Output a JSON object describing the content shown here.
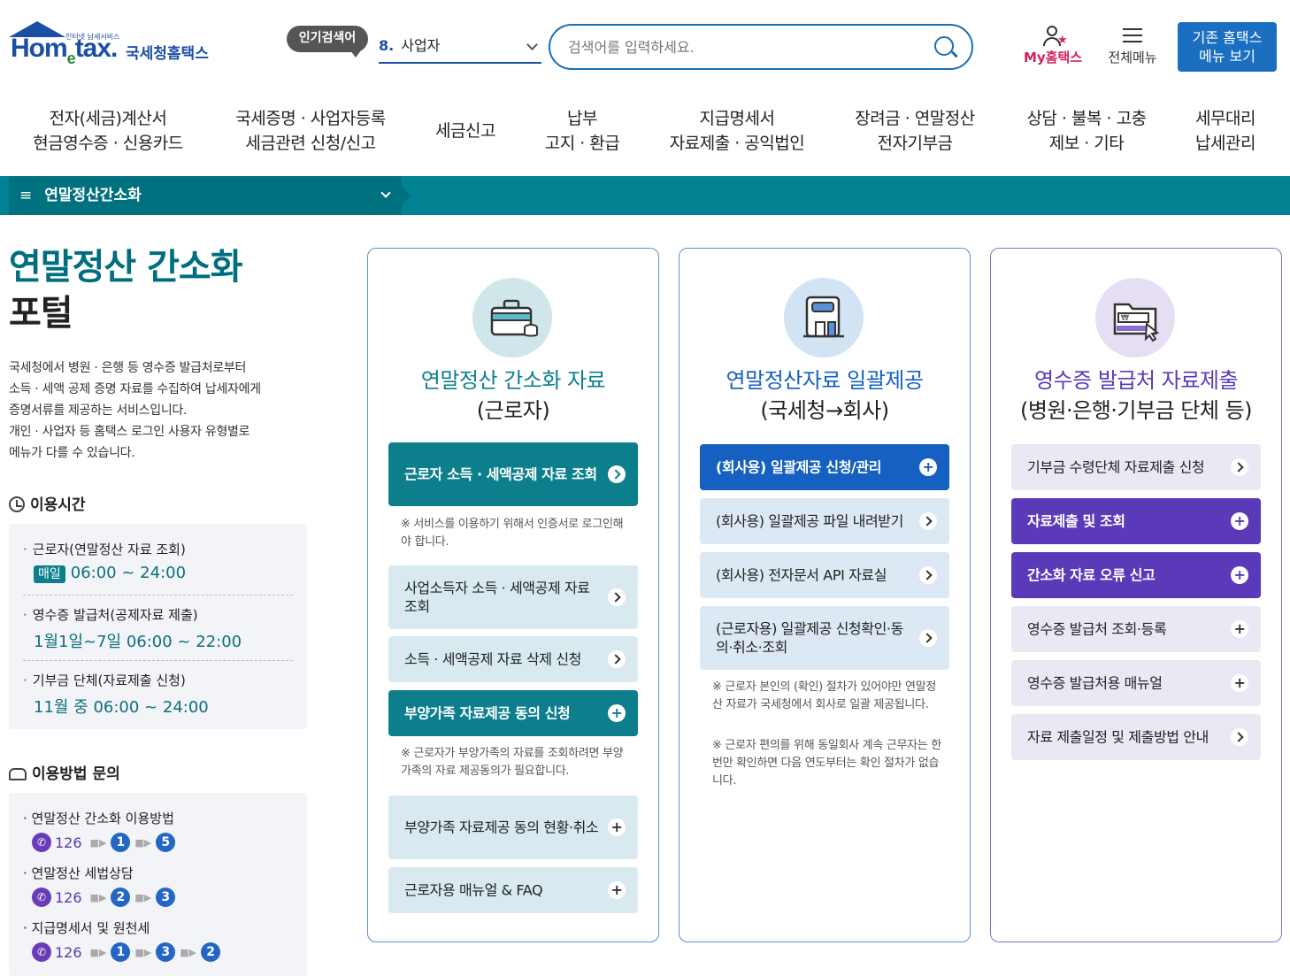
{
  "header": {
    "logo_small": "인터넷 납세서비스",
    "logo_word_a": "Hom",
    "logo_word_e": "e",
    "logo_word_b": "tax.",
    "logo_kor": "국세청홈택스",
    "popular_label": "인기검색어",
    "popular_rank": "8.",
    "popular_term": "사업자",
    "search_placeholder": "검색어를 입력하세요.",
    "my_home": "My홈택스",
    "all_menu": "전체메뉴",
    "old_menu_l1": "기존 홈택스",
    "old_menu_l2": "메뉴 보기"
  },
  "gnb": [
    {
      "l1": "전자(세금)계산서",
      "l2": "현금영수증 · 신용카드"
    },
    {
      "l1": "국세증명 · 사업자등록",
      "l2": "세금관련 신청/신고"
    },
    {
      "l1": "세금신고",
      "l2": ""
    },
    {
      "l1": "납부",
      "l2": "고지 · 환급"
    },
    {
      "l1": "지급명세서",
      "l2": "자료제출 · 공익법인"
    },
    {
      "l1": "장려금 · 연말정산",
      "l2": "전자기부금"
    },
    {
      "l1": "상담 · 불복 · 고충",
      "l2": "제보 · 기타"
    },
    {
      "l1": "세무대리",
      "l2": "납세관리"
    }
  ],
  "breadcrumb": {
    "label": "연말정산간소화",
    "ham": "≡"
  },
  "sidebar": {
    "title_1": "연말정산 간소화",
    "title_2": "포털",
    "desc_1": "국세청에서 병원 · 은행 등 영수증 발급처로부터",
    "desc_2": "소득 · 세액 공제 증명 자료를 수집하여 납세자에게",
    "desc_3": "증명서류를 제공하는 서비스입니다.",
    "desc_4": "개인 · 사업자 등 홈택스 로그인 사용자 유형별로",
    "desc_5": "메뉴가 다를 수 있습니다.",
    "hours_heading": "이용시간",
    "hours": [
      {
        "label": "근로자(연말정산 자료 조회)",
        "badge": "매일",
        "time": "06:00 ~ 24:00"
      },
      {
        "label": "영수증 발급처(공제자료 제출)",
        "badge": "",
        "time": "1월1일~7일 06:00 ~ 22:00"
      },
      {
        "label": "기부금 단체(자료제출 신청)",
        "badge": "",
        "time": "11월 중 06:00 ~ 24:00"
      }
    ],
    "inquiry_heading": "이용방법 문의",
    "contacts": [
      {
        "label": "연말정산 간소화 이용방법",
        "num": "126",
        "steps": [
          "1",
          "5"
        ]
      },
      {
        "label": "연말정산 세법상담",
        "num": "126",
        "steps": [
          "2",
          "3"
        ]
      },
      {
        "label": "지급명세서 및 원천세",
        "num": "126",
        "steps": [
          "1",
          "3",
          "2"
        ]
      }
    ]
  },
  "cards": [
    {
      "title_a": "연말정산 간소화 자료",
      "title_b": "(근로자)",
      "color": "#0d7f8c",
      "buttons": [
        {
          "label": "근로자 소득 · 세액공제 자료 조회"
        },
        {
          "label": "사업소득자 소득 · 세액공제 자료 조회"
        },
        {
          "label": "소득 · 세액공제 자료 삭제 신청"
        },
        {
          "label": "부양가족 자료제공 동의 신청"
        },
        {
          "label": "부양가족 자료제공 동의 현황·취소"
        },
        {
          "label": "근로자용 매뉴얼 & FAQ"
        }
      ],
      "notes": [
        "※ 서비스를 이용하기 위해서 인증서로 로그인해야 합니다.",
        "※ 근로자가 부양가족의 자료를 조회하려면 부양가족의 자료 제공동의가 필요합니다."
      ]
    },
    {
      "title_a": "연말정산자료 일괄제공",
      "title_b": "(국세청→회사)",
      "color": "#1560c0",
      "buttons": [
        {
          "label": "(회사용) 일괄제공 신청/관리"
        },
        {
          "label": "(회사용) 일괄제공 파일 내려받기"
        },
        {
          "label": "(회사용) 전자문서 API 자료실"
        },
        {
          "label": "(근로자용) 일괄제공 신청확인·동의·취소·조회"
        }
      ],
      "notes": [
        "※ 근로자 본인의 (확인) 절차가 있어야만 연말정산 자료가 국세청에서 회사로 일괄 제공됩니다.",
        "※ 근로자 편의를 위해 동일회사 계속 근무자는 한 번만 확인하면 다음 연도부터는 확인 절차가 없습니다."
      ]
    },
    {
      "title_a": "영수증 발급처 자료제출",
      "title_b": "(병원·은행·기부금 단체 등)",
      "color": "#5a3ab8",
      "buttons": [
        {
          "label": "기부금 수령단체 자료제출 신청"
        },
        {
          "label": "자료제출 및 조회"
        },
        {
          "label": "간소화 자료 오류 신고"
        },
        {
          "label": "영수증 발급처 조회·등록"
        },
        {
          "label": "영수증 발급처용 매뉴얼"
        },
        {
          "label": "자료 제출일정 및 제출방법 안내"
        }
      ],
      "notes": []
    }
  ],
  "icons": {
    "plus": "+",
    "phone": "✆",
    "arrow": "■▶"
  }
}
